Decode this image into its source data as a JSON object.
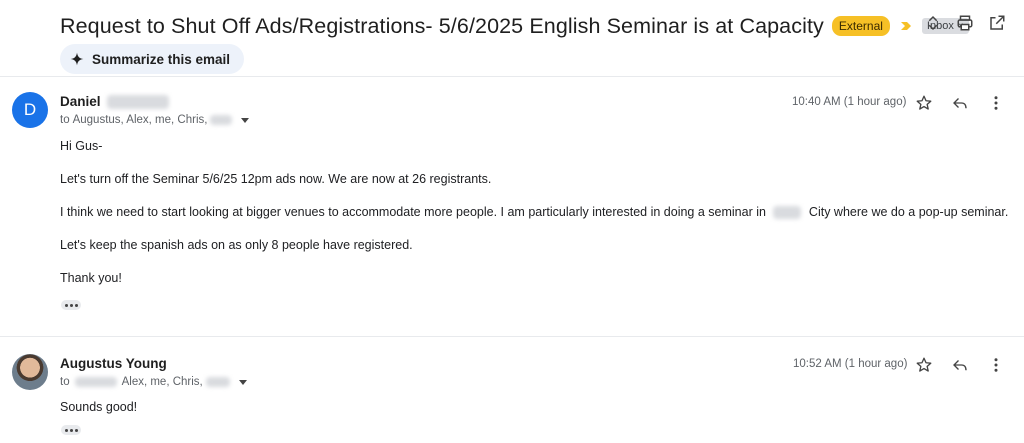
{
  "thread": {
    "subject": "Request to Shut Off Ads/Registrations- 5/6/2025 English Seminar is at Capacity",
    "labels": {
      "external": "External",
      "inbox": "Inbox",
      "inbox_close": "×"
    },
    "summarize_label": "Summarize this email"
  },
  "messages": [
    {
      "sender": "Daniel",
      "avatar_initial": "D",
      "recipients_prefix": "to",
      "recipients_visible": "Augustus, Alex, me, Chris,",
      "time": "10:40 AM (1 hour ago)",
      "greeting": "Hi Gus-",
      "line1": "Let's turn off the Seminar 5/6/25 12pm ads now. We are now at 26 registrants.",
      "line2_before": "I think we need to start looking at bigger venues to accommodate more people. I am particularly interested in doing a seminar in",
      "line2_after": "City where we do a pop-up seminar.",
      "line3": "Let's keep the spanish ads on as only 8 people have registered.",
      "signoff": "Thank you!"
    },
    {
      "sender": "Augustus Young",
      "recipients_prefix": "to",
      "recipients_visible": "Alex, me, Chris,",
      "time": "10:52 AM (1 hour ago)",
      "body": "Sounds good!"
    }
  ],
  "icons": {
    "expand": "unfold-icon",
    "print": "print-icon",
    "open_new": "open-in-new-window-icon",
    "star": "star-icon",
    "reply": "reply-icon",
    "more": "more-vert-icon",
    "sparkle": "sparkle-icon",
    "importance": "importance-marker-icon"
  },
  "colors": {
    "external_label": "#f6c026",
    "avatar_d": "#1a73e8",
    "summarize_bg": "#edf2fa",
    "importance": "#f6c026"
  }
}
